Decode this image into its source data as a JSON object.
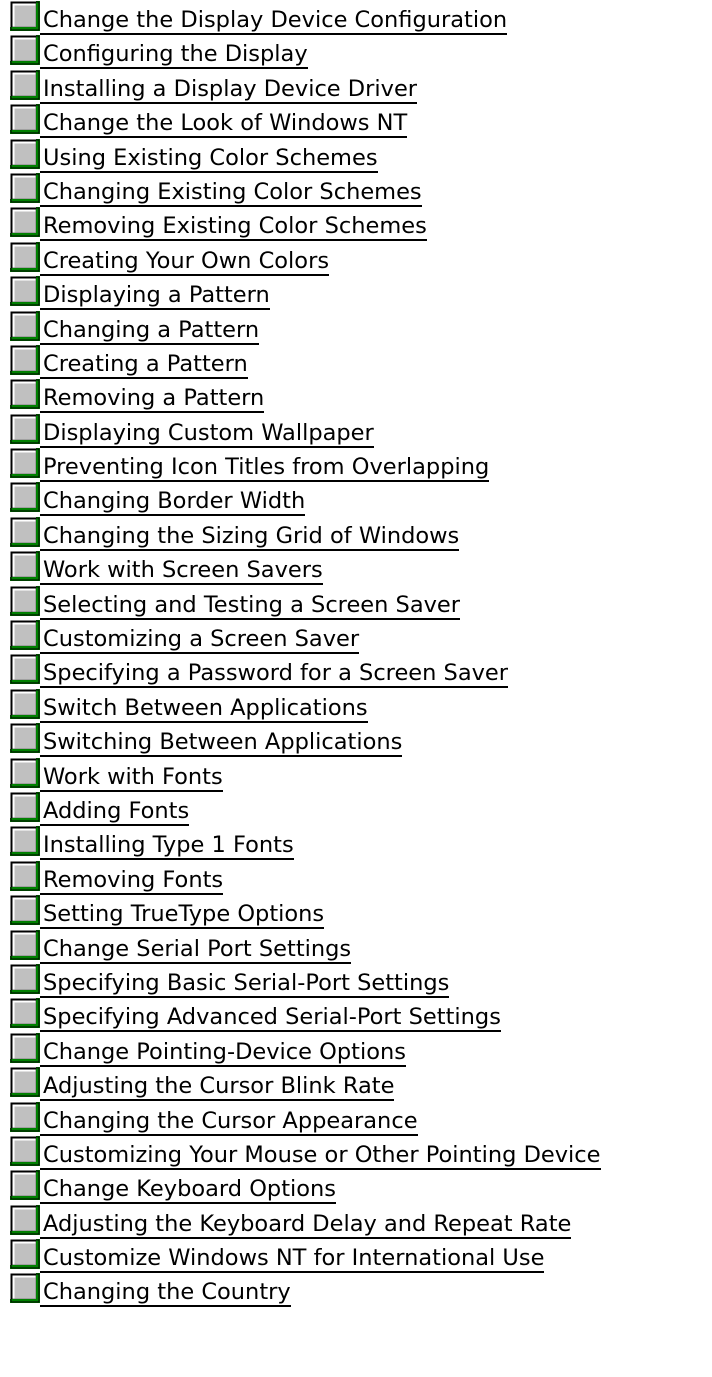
{
  "colors": {
    "background": "#ffffff",
    "text": "#000000",
    "icon_face": "#c0c0c0",
    "icon_highlight": "#ffffff",
    "icon_shadow": "#808080",
    "icon_border": "#000000",
    "icon_accent": "#008000"
  },
  "topic_icon": "gray-square-topic-icon",
  "topics": [
    {
      "label": "Change the Display Device Configuration"
    },
    {
      "label": "Configuring the Display"
    },
    {
      "label": "Installing a Display Device Driver"
    },
    {
      "label": "Change the Look of Windows NT"
    },
    {
      "label": "Using Existing Color Schemes"
    },
    {
      "label": "Changing Existing Color Schemes"
    },
    {
      "label": "Removing Existing Color Schemes"
    },
    {
      "label": "Creating Your Own Colors"
    },
    {
      "label": "Displaying a Pattern"
    },
    {
      "label": "Changing a Pattern"
    },
    {
      "label": "Creating a Pattern"
    },
    {
      "label": "Removing a Pattern"
    },
    {
      "label": "Displaying Custom Wallpaper"
    },
    {
      "label": "Preventing Icon Titles from Overlapping"
    },
    {
      "label": "Changing Border Width"
    },
    {
      "label": "Changing the Sizing Grid of Windows"
    },
    {
      "label": "Work with Screen Savers"
    },
    {
      "label": "Selecting and Testing a Screen Saver"
    },
    {
      "label": "Customizing a Screen Saver"
    },
    {
      "label": "Specifying a Password for a Screen Saver"
    },
    {
      "label": "Switch Between Applications"
    },
    {
      "label": "Switching Between Applications"
    },
    {
      "label": "Work with Fonts"
    },
    {
      "label": "Adding Fonts"
    },
    {
      "label": "Installing Type 1 Fonts"
    },
    {
      "label": "Removing Fonts"
    },
    {
      "label": "Setting TrueType Options"
    },
    {
      "label": "Change Serial Port Settings"
    },
    {
      "label": "Specifying Basic Serial-Port Settings"
    },
    {
      "label": "Specifying Advanced Serial-Port Settings"
    },
    {
      "label": "Change Pointing-Device Options"
    },
    {
      "label": "Adjusting the Cursor Blink Rate"
    },
    {
      "label": "Changing the Cursor Appearance"
    },
    {
      "label": "Customizing Your Mouse or Other Pointing Device"
    },
    {
      "label": "Change Keyboard Options"
    },
    {
      "label": "Adjusting the Keyboard Delay and Repeat Rate"
    },
    {
      "label": "Customize Windows NT for International Use"
    },
    {
      "label": "Changing the Country"
    }
  ]
}
